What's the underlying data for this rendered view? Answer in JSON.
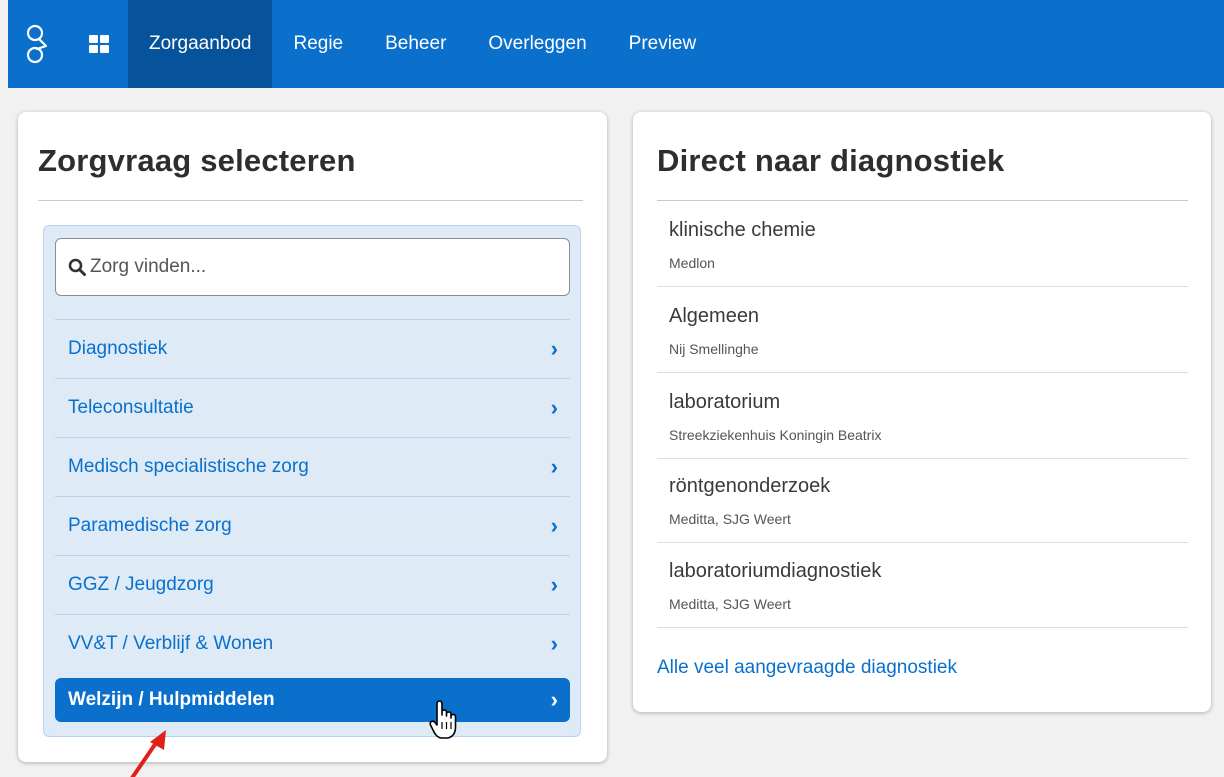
{
  "nav": {
    "items": [
      {
        "label": "Zorgaanbod",
        "active": true
      },
      {
        "label": "Regie",
        "active": false
      },
      {
        "label": "Beheer",
        "active": false
      },
      {
        "label": "Overleggen",
        "active": false
      },
      {
        "label": "Preview",
        "active": false
      }
    ]
  },
  "left": {
    "title": "Zorgvraag selecteren",
    "search_placeholder": "Zorg vinden...",
    "categories": [
      {
        "label": "Diagnostiek"
      },
      {
        "label": "Teleconsultatie"
      },
      {
        "label": "Medisch specialistische zorg"
      },
      {
        "label": "Paramedische zorg"
      },
      {
        "label": "GGZ / Jeugdzorg"
      },
      {
        "label": "VV&T / Verblijf & Wonen"
      },
      {
        "label": "Welzijn / Hulpmiddelen"
      }
    ],
    "chevron": "›"
  },
  "right": {
    "title": "Direct naar diagnostiek",
    "items": [
      {
        "name": "klinische chemie",
        "org": "Medlon"
      },
      {
        "name": "Algemeen",
        "org": "Nij Smellinghe"
      },
      {
        "name": "laboratorium",
        "org": "Streekziekenhuis Koningin Beatrix"
      },
      {
        "name": "röntgenonderzoek",
        "org": "Meditta, SJG Weert"
      },
      {
        "name": "laboratoriumdiagnostiek",
        "org": "Meditta, SJG Weert"
      }
    ],
    "all_link": "Alle veel aangevraagde diagnostiek"
  },
  "colors": {
    "brand": "#0a70cc",
    "brand_dark": "#07539b",
    "list_bg": "#deebf7",
    "annotation_arrow": "#e0201b"
  },
  "icons": [
    "app-logo-icon",
    "grid-icon",
    "search-icon",
    "chevron-right-icon",
    "hand-cursor-icon",
    "annotation-arrow-icon"
  ]
}
